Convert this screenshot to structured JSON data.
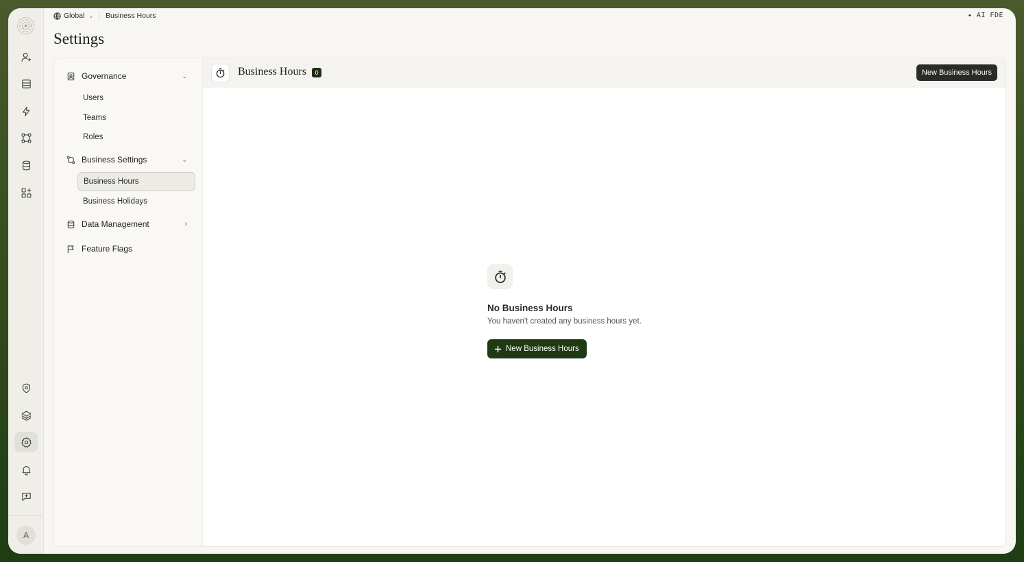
{
  "breadcrumb": {
    "scope": "Global",
    "current": "Business Hours"
  },
  "topbar": {
    "ai_label": "AI FDE"
  },
  "page_title": "Settings",
  "rail": {
    "avatar_initial": "A",
    "icons": [
      "user-plus-icon",
      "inbox-icon",
      "bolt-icon",
      "workflow-icon",
      "database-icon",
      "apps-icon",
      "shield-icon",
      "layers-icon",
      "gear-icon",
      "bell-icon",
      "feedback-icon"
    ],
    "active": "gear-icon"
  },
  "sidebar": {
    "governance": {
      "label": "Governance",
      "items": [
        "Users",
        "Teams",
        "Roles"
      ]
    },
    "business_settings": {
      "label": "Business Settings",
      "items": [
        "Business Hours",
        "Business Holidays"
      ],
      "active": "Business Hours"
    },
    "data_management": {
      "label": "Data Management"
    },
    "feature_flags": {
      "label": "Feature Flags"
    }
  },
  "content": {
    "title": "Business Hours",
    "count": "0",
    "new_button": "New Business Hours",
    "empty": {
      "title": "No Business Hours",
      "subtitle": "You haven't created any business hours yet.",
      "button": "New Business Hours"
    }
  },
  "colors": {
    "accent": "#1f3a12",
    "badge": "#1f2d14",
    "header_button": "#2a2a28"
  }
}
